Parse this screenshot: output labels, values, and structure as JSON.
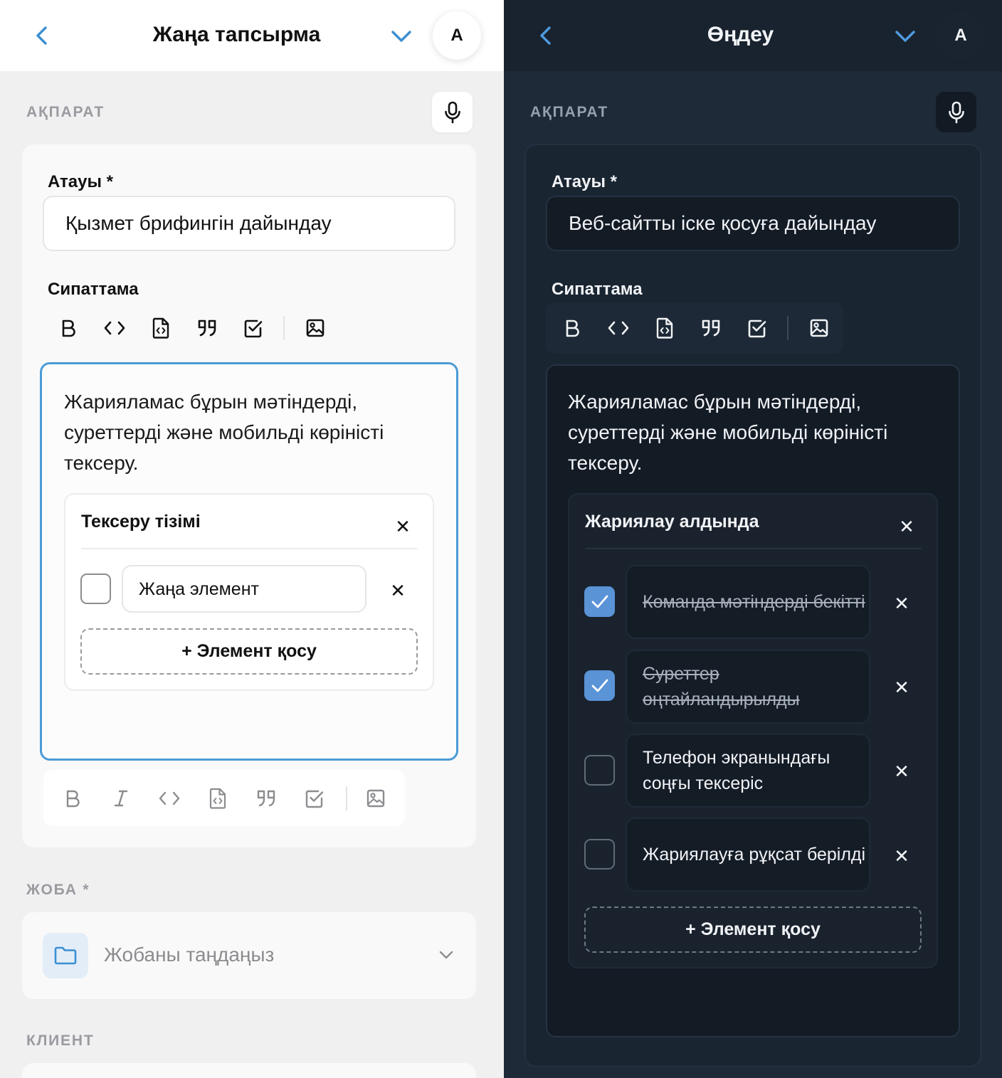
{
  "light": {
    "header": {
      "title": "Жаңа тапсырма",
      "avatar_letter": "А"
    },
    "section_info_label": "АҚПАРАТ",
    "title_label": "Атауы *",
    "title_value": "Қызмет брифингін дайындау",
    "description_label": "Сипаттама",
    "description_text": "Жарияламас бұрын мәтіндерді, суреттерді және мобильді көріністі тексеру.",
    "checklist": {
      "title": "Тексеру тізімі",
      "new_item_value": "Жаңа элемент",
      "add_item_label": "+ Элемент қосу"
    },
    "project_label": "ЖОБА *",
    "project_placeholder": "Жобаны таңдаңыз",
    "client_label": "КЛИЕНТ"
  },
  "dark": {
    "header": {
      "title": "Өңдеу",
      "avatar_letter": "А"
    },
    "section_info_label": "АҚПАРАТ",
    "title_label": "Атауы *",
    "title_value": "Веб-сайтты іске қосуға дайындау",
    "description_label": "Сипаттама",
    "description_text": "Жарияламас бұрын мәтіндерді, суреттерді және мобильді көріністі тексеру.",
    "checklist": {
      "title": "Жариялау алдында",
      "items": [
        {
          "text": "Команда мәтіндерді бекітті",
          "checked": true
        },
        {
          "text": "Суреттер оңтайландырылды",
          "checked": true
        },
        {
          "text": "Телефон экранындағы соңғы тексеріс",
          "checked": false
        },
        {
          "text": "Жариялауға рұқсат берілді",
          "checked": false
        }
      ],
      "add_item_label": "+ Элемент қосу"
    }
  },
  "icons": {
    "back": "chevron-left-icon",
    "dropdown": "chevron-down-icon",
    "mic": "microphone-icon",
    "toolbar": [
      "bold-icon",
      "code-icon",
      "code-file-icon",
      "quote-icon",
      "checkbox-icon",
      "image-icon"
    ],
    "toolbar_bottom": [
      "bold-icon",
      "italic-icon",
      "code-icon",
      "code-file-icon",
      "quote-icon",
      "checkbox-icon",
      "image-icon"
    ],
    "remove": "close-icon",
    "folder": "folder-icon"
  },
  "colors": {
    "accent": "#4a9bd6",
    "light_background": "#f0f0f1",
    "dark_background": "#1e2a38",
    "checkbox_checked": "#5a93d6"
  }
}
